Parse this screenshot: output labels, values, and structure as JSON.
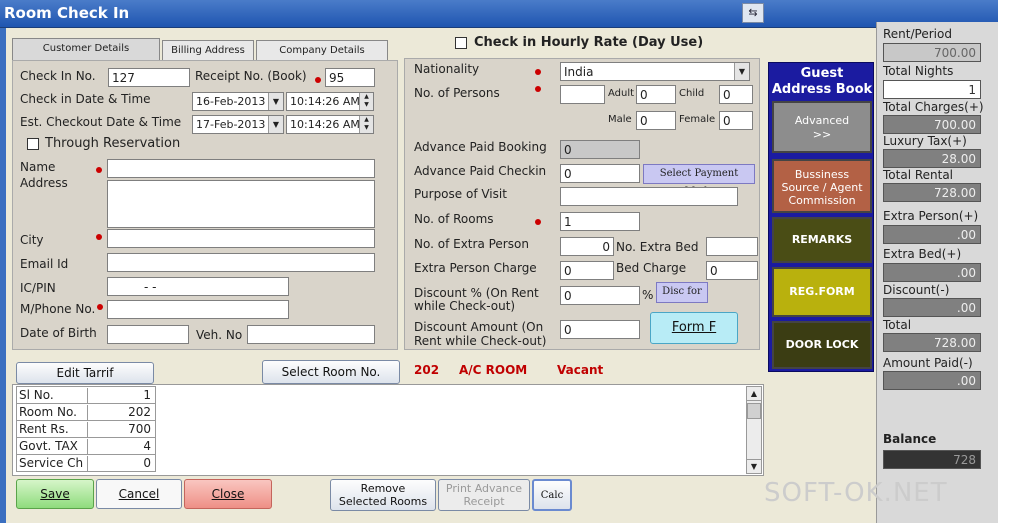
{
  "window": {
    "title": "Room Check In"
  },
  "tabs": [
    "Customer Details",
    "Billing Address",
    "Company Details"
  ],
  "hourly": {
    "label": "Check in Hourly Rate (Day Use)"
  },
  "customer": {
    "checkin_no_label": "Check In No.",
    "checkin_no": "127",
    "receipt_label": "Receipt No. (Book)",
    "receipt_no": "95",
    "checkin_date_label": "Check in Date & Time",
    "checkin_date": "16-Feb-2013",
    "checkin_time": "10:14:26 AM",
    "checkout_label": "Est. Checkout Date & Time",
    "checkout_date": "17-Feb-2013",
    "checkout_time": "10:14:26 AM",
    "through_res_label": "Through Reservation",
    "name_label": "Name",
    "address_label": "Address",
    "city_label": "City",
    "email_label": "Email Id",
    "icpin_label": "IC/PIN",
    "icpin_value": "- -",
    "phone_label": "M/Phone No.",
    "dob_label": "Date of Birth",
    "vehno_label": "Veh. No"
  },
  "middle": {
    "nationality_label": "Nationality",
    "nationality": "India",
    "persons_label": "No. of Persons",
    "adult_label": "Adult",
    "adult": "0",
    "child_label": "Child",
    "child": "0",
    "male_label": "Male",
    "male": "0",
    "female_label": "Female",
    "female": "0",
    "adv_booking_label": "Advance Paid Booking",
    "adv_booking": "0",
    "adv_checkin_label": "Advance Paid Checkin",
    "adv_checkin": "0",
    "payment_mode_btn": "Select Payment Mode",
    "purpose_label": "Purpose of Visit",
    "rooms_label": "No. of Rooms",
    "rooms": "1",
    "extra_person_label": "No. of Extra Person",
    "extra_person": "0",
    "extra_bed_label": "No. Extra Bed",
    "extra_person_charge_label": "Extra Person Charge",
    "extra_person_charge": "0",
    "bed_charge_label": "Bed Charge",
    "bed_charge": "0",
    "discount_pct_label1": "Discount % (On Rent",
    "discount_pct_label2": "while Check-out)",
    "discount_pct": "0",
    "pct_sign": "%",
    "disc_for_btn": "Disc for",
    "discount_amt_label1": "Discount Amount (On",
    "discount_amt_label2": "Rent while Check-out)",
    "discount_amt": "0",
    "form_f_btn": "Form F"
  },
  "guest_panel": {
    "title1": "Guest",
    "title2": "Address Book",
    "advanced1": "Advanced",
    "advanced2": ">>",
    "business1": "Bussiness",
    "business2": "Source / Agent",
    "business3": "Commission",
    "remarks": "REMARKS",
    "regform": "REG.FORM",
    "doorlock": "DOOR LOCK"
  },
  "room_info": {
    "edit_tariff": "Edit Tarrif",
    "select_room": "Select Room No.",
    "number": "202",
    "type": "A/C ROOM",
    "status": "Vacant"
  },
  "room_table": [
    {
      "k": "Sl No.",
      "v": "1"
    },
    {
      "k": "Room No.",
      "v": "202"
    },
    {
      "k": "Rent Rs.",
      "v": "700"
    },
    {
      "k": "Govt. TAX",
      "v": "4"
    },
    {
      "k": "Service Ch",
      "v": "0"
    }
  ],
  "buttons": {
    "save": "Save",
    "cancel": "Cancel",
    "close": "Close",
    "remove1": "Remove",
    "remove2": "Selected Rooms",
    "print1": "Print Advance",
    "print2": "Receipt",
    "calc": "Calc"
  },
  "summary": {
    "rent_period_label": "Rent/Period",
    "rent_period": "700.00",
    "nights_label": "Total Nights",
    "nights": "1",
    "charges_label": "Total Charges(+)",
    "charges": "700.00",
    "luxury_label": "Luxury Tax(+)",
    "luxury": "28.00",
    "rental_label": "Total Rental",
    "rental": "728.00",
    "extra_person_label": "Extra Person(+)",
    "extra_person": ".00",
    "extra_bed_label": "Extra Bed(+)",
    "extra_bed": ".00",
    "discount_label": "Discount(-)",
    "discount": ".00",
    "total_label": "Total",
    "total": "728.00",
    "paid_label": "Amount Paid(-)",
    "paid": ".00",
    "balance_label": "Balance",
    "balance": "728"
  },
  "watermark": "SOFT-OK.NET",
  "colors": {
    "titlebar": "#1f55b0",
    "guest_panel": "#1b1ba0",
    "required_dot": "#cc0000",
    "room_info": "#c00000"
  }
}
